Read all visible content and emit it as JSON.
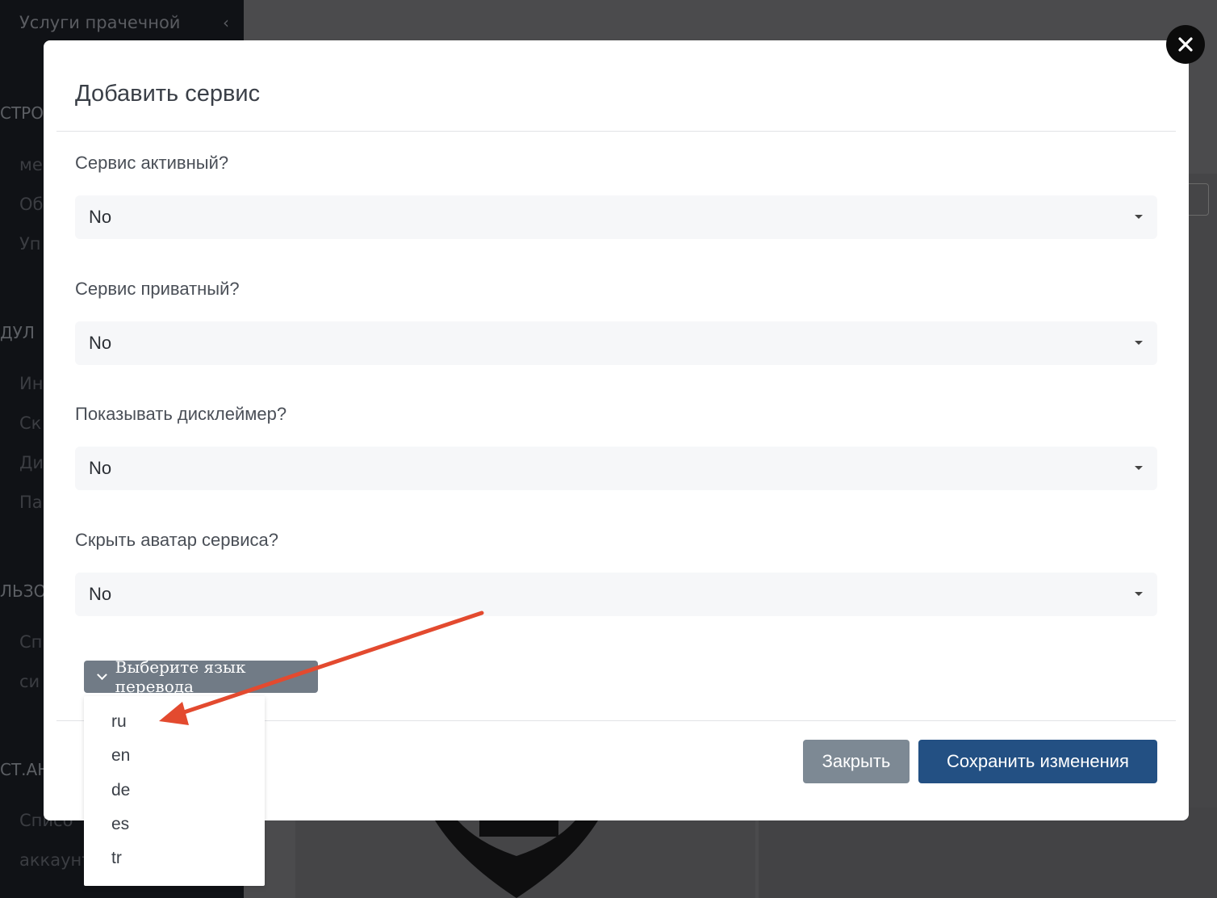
{
  "background": {
    "sidebar_top_item": "Услуги прачечной",
    "sidebar_fragments": [
      "СТРО",
      "ме",
      "Об",
      "Уп",
      "ДУЛ",
      "Ин",
      "Ск",
      "Ди",
      "Па",
      "ЛЬЗО",
      "Сп",
      "си",
      "СТ.АН",
      "Списо",
      "аккаунт"
    ]
  },
  "modal": {
    "title": "Добавить сервис",
    "fields": [
      {
        "label": "Сервис активный?",
        "value": "No"
      },
      {
        "label": "Сервис приватный?",
        "value": "No"
      },
      {
        "label": "Показывать дисклеймер?",
        "value": "No"
      },
      {
        "label": "Скрыть аватар сервиса?",
        "value": "No"
      }
    ],
    "language_button": "Выберите язык перевода",
    "language_options": [
      "ru",
      "en",
      "de",
      "es",
      "tr"
    ],
    "buttons": {
      "close": "Закрыть",
      "save": "Сохранить изменения"
    }
  },
  "colors": {
    "primary": "#235083",
    "secondary": "#7d8994",
    "annotation_arrow": "#e34a2f",
    "overlay": "#4b4b4d"
  },
  "icons": {
    "close": "close-icon",
    "caret": "caret-down-icon",
    "chevron": "chevron-down-icon"
  }
}
